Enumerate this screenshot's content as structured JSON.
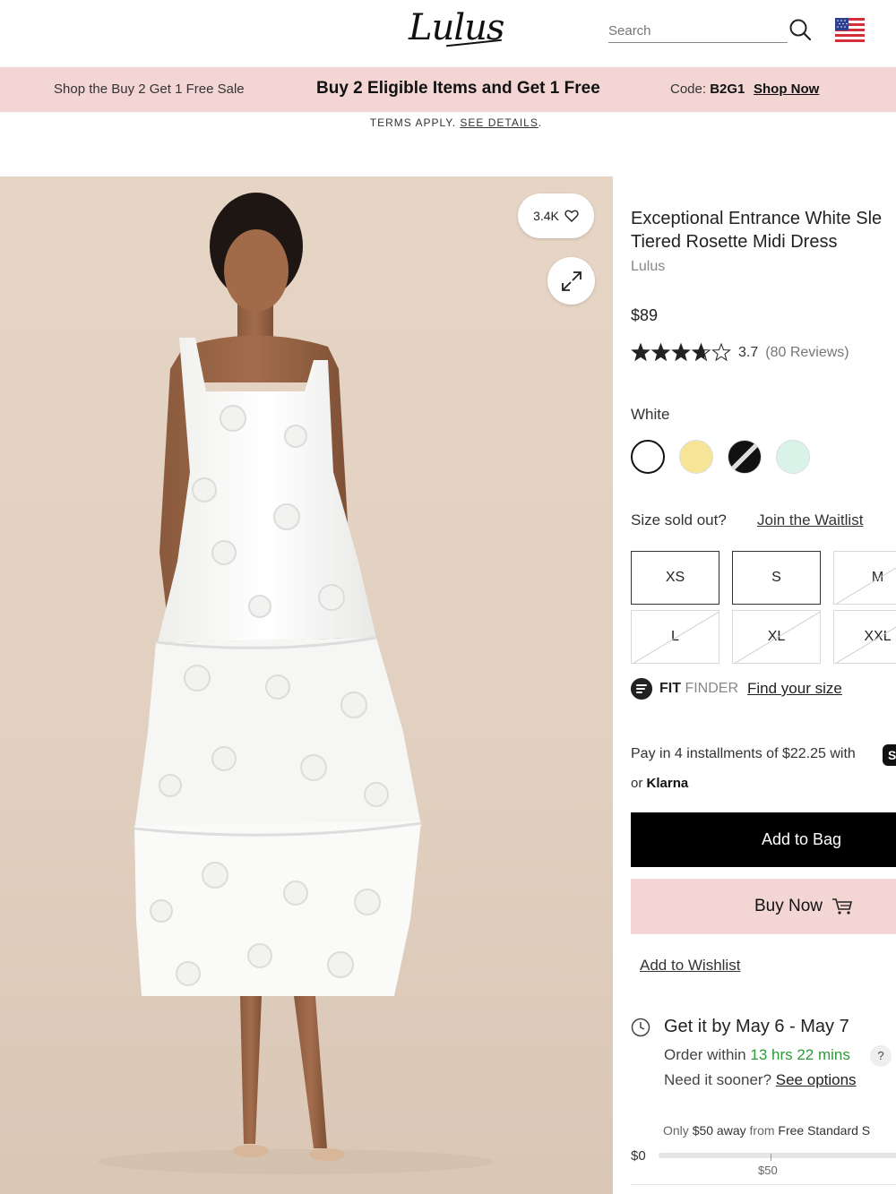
{
  "header": {
    "logo_text": "Lulus",
    "search_placeholder": "Search",
    "search_icon": "search-icon",
    "flag_icon": "us-flag-icon"
  },
  "promo": {
    "left_link": "Shop the Buy 2 Get 1 Free Sale",
    "headline": "Buy 2 Eligible Items and Get 1 Free",
    "code_label": "Code:",
    "code_value": "B2G1",
    "shop_now": "Shop Now",
    "terms_text": "TERMS APPLY.",
    "terms_link": "SEE DETAILS"
  },
  "gallery": {
    "likes_count": "3.4K",
    "heart_icon": "heart-icon",
    "expand_icon": "expand-icon"
  },
  "product": {
    "title_line1": "Exceptional Entrance White Sle",
    "title_line2": "Tiered Rosette Midi Dress",
    "brand": "Lulus",
    "price": "$89",
    "rating_value": 3.7,
    "rating_text": "3.7",
    "reviews_text": "(80 Reviews)",
    "color_label": "White",
    "swatches": [
      {
        "name": "White",
        "color": "#ffffff",
        "selected": true
      },
      {
        "name": "Yellow",
        "color": "#f7e597",
        "selected": false
      },
      {
        "name": "Black",
        "color": "#111111",
        "selected": false
      },
      {
        "name": "Mint",
        "color": "#d9f3e9",
        "selected": false
      }
    ],
    "size_question": "Size sold out?",
    "waitlist_link": "Join the Waitlist",
    "sizes": [
      {
        "label": "XS",
        "available": true
      },
      {
        "label": "S",
        "available": true
      },
      {
        "label": "M",
        "available": false
      },
      {
        "label": "L",
        "available": false
      },
      {
        "label": "XL",
        "available": false
      },
      {
        "label": "XXL",
        "available": false
      }
    ],
    "fit_finder": {
      "fit": "FIT",
      "finder": "FINDER",
      "link": "Find your size"
    },
    "installments_text": "Pay in 4 installments of $22.25 with",
    "installments_badge": "S",
    "klarna_prefix": "or",
    "klarna_name": "Klarna",
    "add_to_bag": "Add to Bag",
    "buy_now": "Buy Now",
    "cart_icon": "cart-icon",
    "add_to_wishlist": "Add to Wishlist"
  },
  "delivery": {
    "clock_icon": "clock-icon",
    "headline": "Get it by May 6 - May 7",
    "order_prefix": "Order within",
    "order_time": "13 hrs 22 mins",
    "help_mark": "?",
    "sooner_text": "Need it sooner?",
    "sooner_link": "See options",
    "accent_color": "#2d9b3a"
  },
  "shipping": {
    "only": "Only",
    "amount_away": "$50 away",
    "from": "from",
    "free_label": "Free Standard S",
    "start_label": "$0",
    "goal_label": "$50",
    "progress": 0
  },
  "colors": {
    "promo_bg": "#f3d6d4",
    "button_primary": "#000000",
    "button_secondary": "#f3d6d4"
  }
}
